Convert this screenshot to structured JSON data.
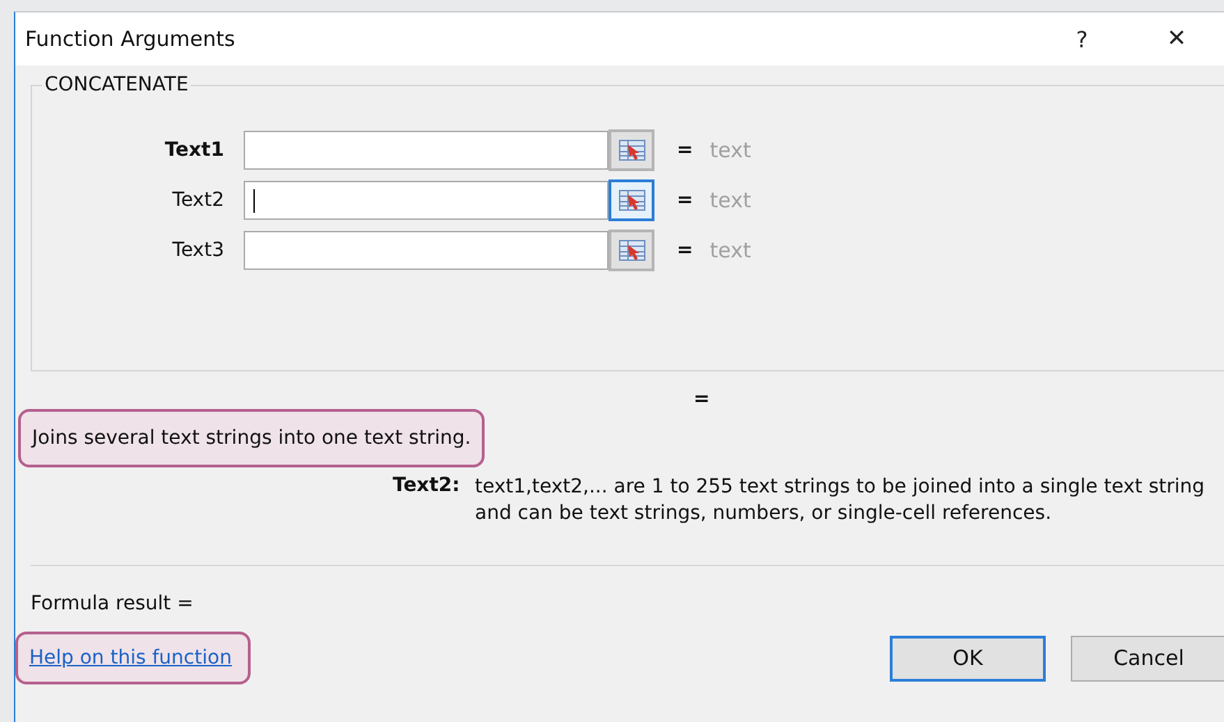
{
  "window": {
    "title": "Function Arguments",
    "help_glyph": "?",
    "close_glyph": "✕"
  },
  "function_group": {
    "name": "CONCATENATE",
    "arguments": [
      {
        "label": "Text1",
        "required": true,
        "focused": false,
        "equals": "=",
        "result": "text"
      },
      {
        "label": "Text2",
        "required": false,
        "focused": true,
        "equals": "=",
        "result": "text"
      },
      {
        "label": "Text3",
        "required": false,
        "focused": false,
        "equals": "=",
        "result": "text"
      }
    ]
  },
  "function_result_equals": "=",
  "description": "Joins several text strings into one text string.",
  "argument_help": {
    "name": "Text2:",
    "text": "text1,text2,... are 1 to 255 text strings to be joined into a single text string and can be text strings, numbers, or single-cell references."
  },
  "formula_result": "Formula result =",
  "help_link": "Help on this function",
  "buttons": [
    {
      "label": "OK",
      "default": true
    },
    {
      "label": "Cancel",
      "default": false
    }
  ]
}
